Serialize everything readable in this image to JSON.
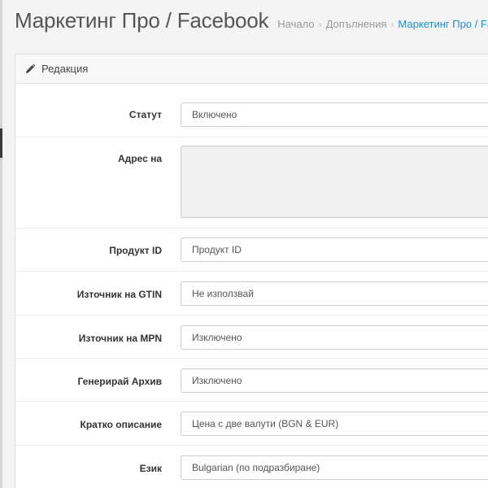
{
  "header": {
    "title": "Маркетинг Про / Facebook",
    "breadcrumb": [
      "Начало",
      "Допълнения",
      "Маркетинг Про / Facebook"
    ]
  },
  "panel": {
    "heading": "Редакция",
    "heading_icon": "pencil-icon"
  },
  "form": {
    "status_label": "Статут",
    "status_value": "Включено",
    "address_label": "Адрес на",
    "address_value": "",
    "product_id_label": "Продукт ID",
    "product_id_value": "Продукт ID",
    "gtin_label": "Източник на GTIN",
    "gtin_value": "Не използвай",
    "mpn_label": "Източник на MPN",
    "mpn_value": "Изключено",
    "archive_label": "Генерирай Архив",
    "archive_value": "Изключено",
    "short_desc_label": "Кратко описание",
    "short_desc_value": "Цена с две валути (BGN & EUR)",
    "language_label": "Език",
    "language_value": "Bulgarian (по подразбиране)"
  },
  "colors": {
    "accent": "#1e91cf",
    "title": "#555555",
    "muted": "#999999"
  }
}
